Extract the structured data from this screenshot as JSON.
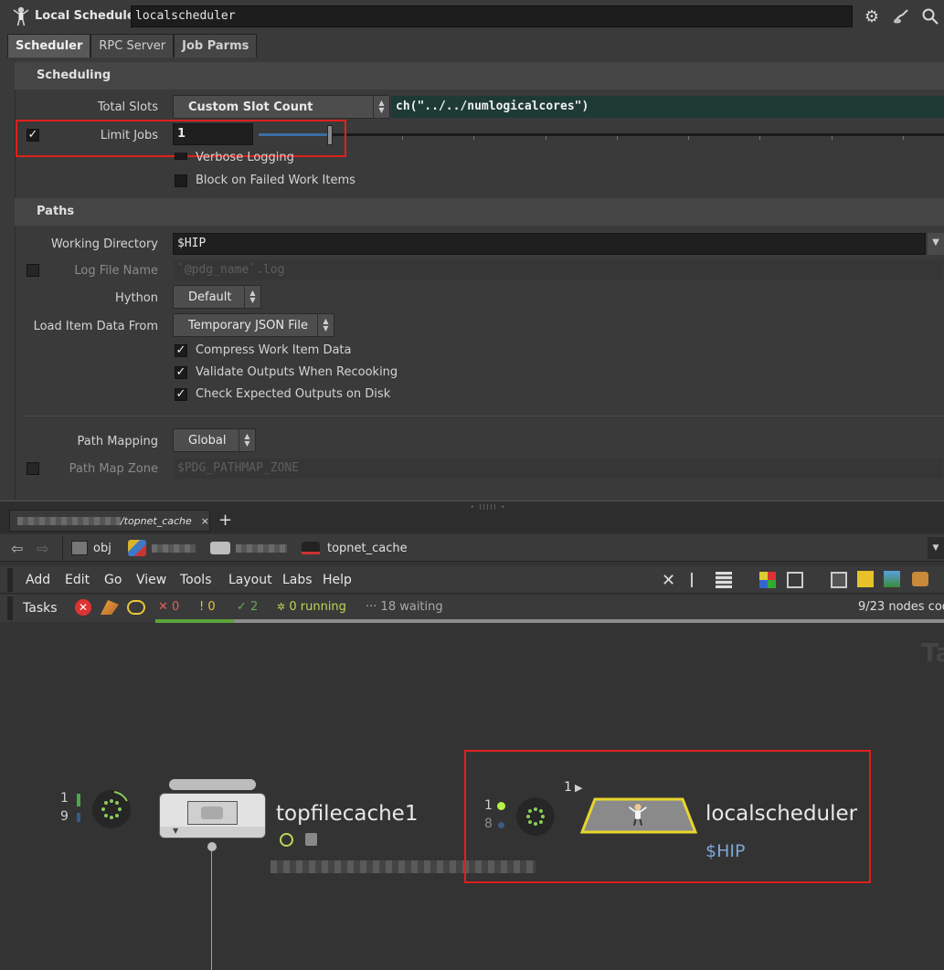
{
  "header": {
    "node_type": "Local Scheduler",
    "node_name": "localscheduler"
  },
  "tabs": [
    {
      "label": "Scheduler"
    },
    {
      "label": "RPC Server"
    },
    {
      "label": "Job Parms"
    }
  ],
  "scheduling": {
    "title": "Scheduling",
    "total_slots_label": "Total Slots",
    "total_slots_value": "Custom Slot Count",
    "total_slots_expr": "ch(\"../../numlogicalcores\")",
    "limit_jobs_label": "Limit Jobs",
    "limit_jobs_value": "1",
    "limit_jobs_checked": true,
    "verbose_logging_label": "Verbose Logging",
    "block_failed_label": "Block on Failed Work Items"
  },
  "paths": {
    "title": "Paths",
    "working_dir_label": "Working Directory",
    "working_dir_value": "$HIP",
    "log_file_label": "Log File Name",
    "log_file_value": "`@pdg_name`.log",
    "hython_label": "Hython",
    "hython_value": "Default",
    "load_item_label": "Load Item Data From",
    "load_item_value": "Temporary JSON File",
    "compress_label": "Compress Work Item Data",
    "validate_label": "Validate Outputs When Recooking",
    "check_expected_label": "Check Expected Outputs on Disk",
    "path_mapping_label": "Path Mapping",
    "path_mapping_value": "Global",
    "path_map_zone_label": "Path Map Zone",
    "path_map_zone_value": "$PDG_PATHMAP_ZONE"
  },
  "network_tab": {
    "path": "/topnet_cache",
    "close": "×",
    "add": "+"
  },
  "breadcrumb": {
    "obj": "obj",
    "current": "topnet_cache"
  },
  "menu": [
    "Add",
    "Edit",
    "Go",
    "View",
    "Tools",
    "Layout",
    "Labs",
    "Help"
  ],
  "tasks": {
    "label": "Tasks",
    "failed": "✕ 0",
    "warnings": "! 0",
    "done": "✓ 2",
    "running": "0 running",
    "waiting": "18 waiting",
    "nodes_cooked": "9/23 nodes coo",
    "progress": 0.1
  },
  "nodes": {
    "filecache": {
      "name": "topfilecache1",
      "count_top": "1",
      "count_bottom": "9"
    },
    "scheduler": {
      "name": "localscheduler",
      "subtitle": "$HIP",
      "count_top": "1",
      "count_bottom": "8",
      "output_count": "1"
    }
  },
  "watermark": "Ta",
  "colors": {
    "accent_blue": "#3b6ea5",
    "highlight_red": "#e0201c",
    "expr_bg": "#1e3a35",
    "node_yellow": "#e8d52c",
    "status_green": "#5aa33a",
    "link_blue": "#7fa6d8"
  }
}
